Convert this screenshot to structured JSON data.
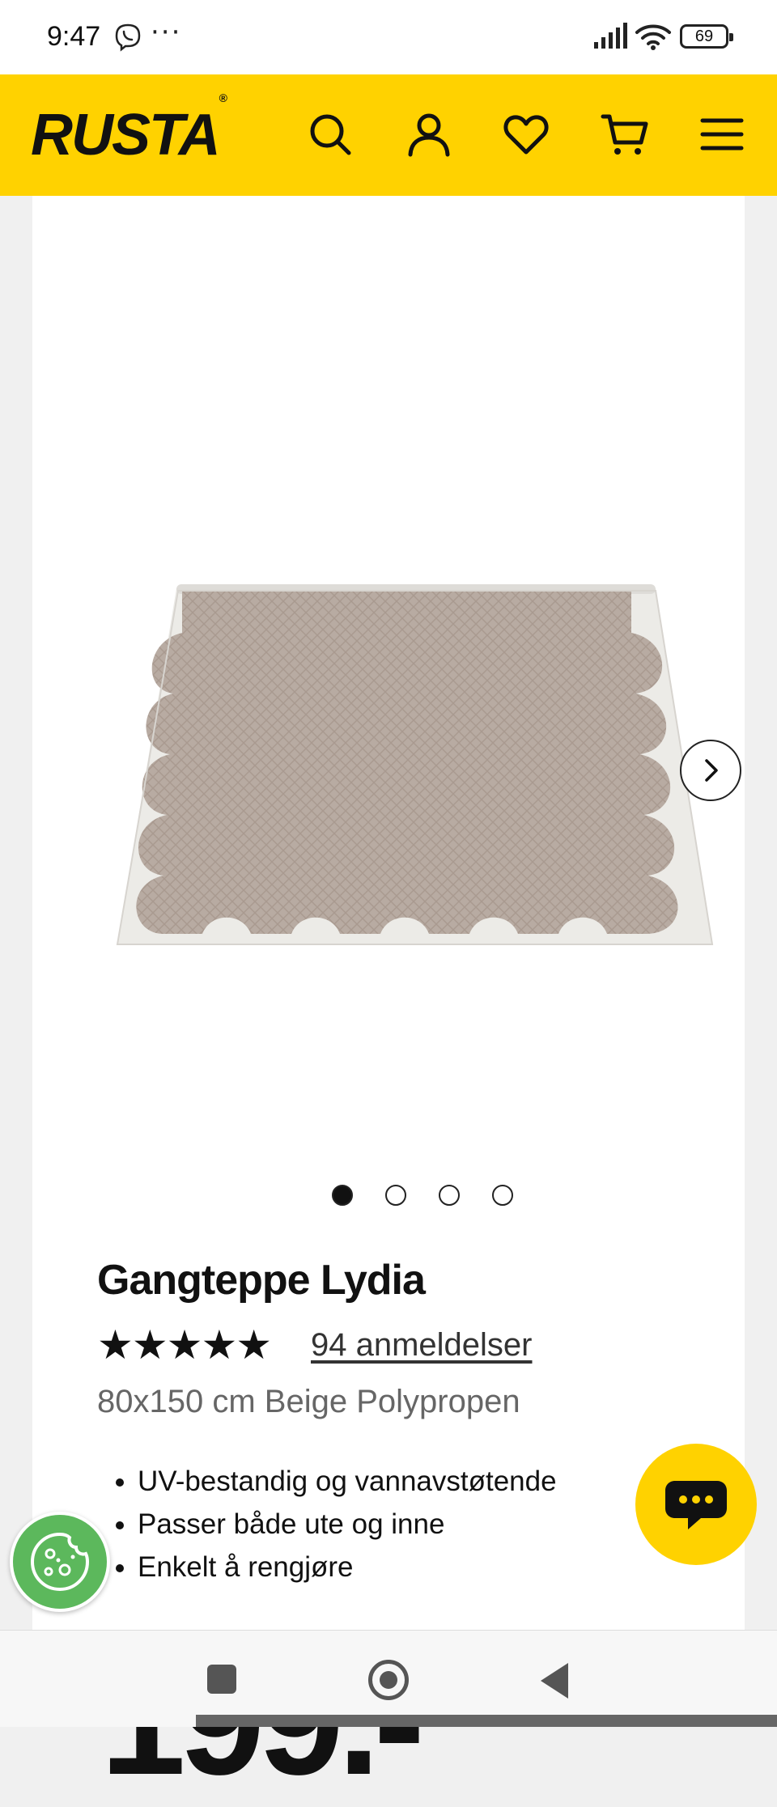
{
  "status_bar": {
    "time": "9:47",
    "more": "···",
    "battery": "69",
    "icons": [
      "viber-icon",
      "signal-icon",
      "wifi-icon",
      "battery-icon"
    ]
  },
  "header": {
    "logo": "RUSTA",
    "logo_mark": "®",
    "background": "#ffd200",
    "icons": [
      "search-icon",
      "account-icon",
      "wishlist-icon",
      "cart-icon",
      "menu-icon"
    ]
  },
  "gallery": {
    "active_index": 0,
    "total_images": 4
  },
  "product": {
    "title": "Gangteppe Lydia",
    "rating": 5,
    "stars": "★★★★★",
    "reviews_link": "94 anmeldelser",
    "subtitle": "80x150 cm Beige Polypropen",
    "features": [
      "UV-bestandig og vannavstøtende",
      "Passer både ute og inne",
      "Enkelt å rengjøre"
    ],
    "price": "199.-"
  },
  "floating": {
    "chat": "chat-icon",
    "cookie": "cookie-icon",
    "cookie_color": "#5cb85c"
  },
  "navbar": {
    "icons": [
      "recents-icon",
      "home-icon",
      "back-icon"
    ]
  }
}
